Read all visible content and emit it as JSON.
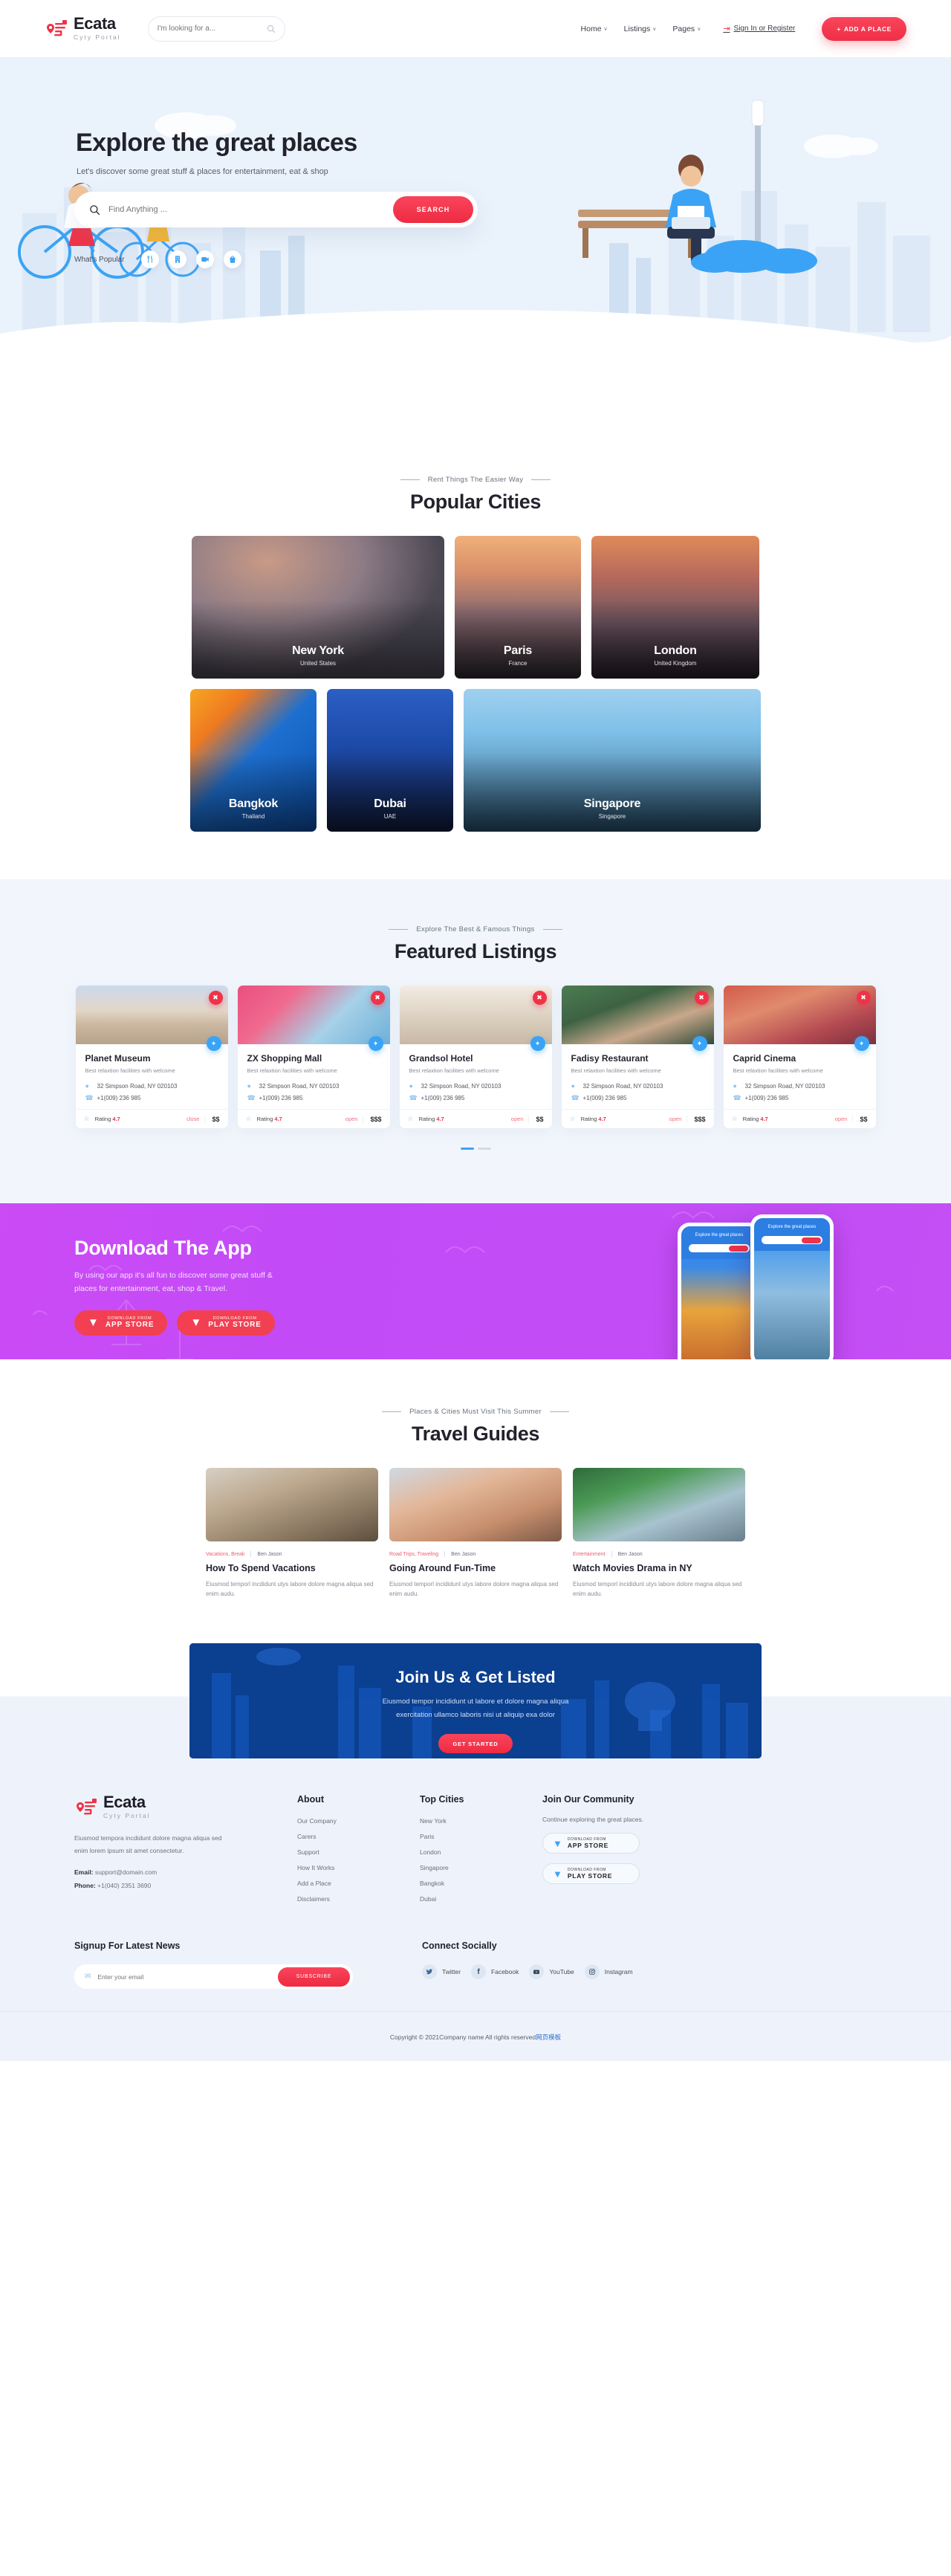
{
  "brand": {
    "name": "Ecata",
    "tagline": "Cyty Portal",
    "logo_icon": "location-pin-icon"
  },
  "header": {
    "search_placeholder": "I'm looking for a...",
    "search_icon": "search-icon",
    "nav": [
      {
        "label": "Home",
        "caret": "∨"
      },
      {
        "label": "Listings",
        "caret": "∨"
      },
      {
        "label": "Pages",
        "caret": "∨"
      }
    ],
    "signin_label": "Sign In or Register",
    "signin_icon": "login-icon",
    "add_place_label": "ADD A PLACE",
    "add_place_icon": "plus-icon"
  },
  "hero": {
    "title": "Explore the great places",
    "subtitle": "Let's discover some great stuff & places for entertainment, eat & shop",
    "search_placeholder": "Find Anything ...",
    "search_icon": "search-icon",
    "search_button": "SEARCH",
    "popular_label": "What's Popular",
    "popular_icons": [
      {
        "name": "restaurant-icon",
        "glyph": "✖"
      },
      {
        "name": "hotel-icon",
        "glyph": "☷"
      },
      {
        "name": "video-icon",
        "glyph": "▶"
      },
      {
        "name": "shopping-icon",
        "glyph": "▮"
      }
    ]
  },
  "cities_section": {
    "kicker": "Rent Things The Easier Way",
    "title": "Popular Cities",
    "cities": [
      {
        "name": "New York",
        "country": "United States",
        "class": "c-ny ph-ny"
      },
      {
        "name": "Paris",
        "country": "France",
        "class": "c-paris ph-paris"
      },
      {
        "name": "London",
        "country": "United Kingdom",
        "class": "c-london ph-london"
      },
      {
        "name": "Bangkok",
        "country": "Thailand",
        "class": "c-bangkok ph-bangkok"
      },
      {
        "name": "Dubai",
        "country": "UAE",
        "class": "c-dubai ph-dubai"
      },
      {
        "name": "Singapore",
        "country": "Singapore",
        "class": "c-singapore ph-singapore"
      }
    ]
  },
  "featured_section": {
    "kicker": "Explore The Best & Famous Things",
    "title": "Featured Listings",
    "listings": [
      {
        "title": "Planet Museum",
        "desc": "Best relaxtion facilities with welcome",
        "address": "32 Simpson Road, NY 020103",
        "phone": "+1(009) 236 985",
        "rating_label": "Rating",
        "rating": "4.7",
        "status": "close",
        "price": "$$",
        "img_class": "ph-museum"
      },
      {
        "title": "ZX Shopping Mall",
        "desc": "Best relaxtion facilities with welcome",
        "address": "32 Simpson Road, NY 020103",
        "phone": "+1(009) 236 985",
        "rating_label": "Rating",
        "rating": "4.7",
        "status": "open",
        "price": "$$$",
        "img_class": "ph-mall"
      },
      {
        "title": "Grandsol Hotel",
        "desc": "Best relaxtion facilities with welcome",
        "address": "32 Simpson Road, NY 020103",
        "phone": "+1(009) 236 985",
        "rating_label": "Rating",
        "rating": "4.7",
        "status": "open",
        "price": "$$",
        "img_class": "ph-hotel"
      },
      {
        "title": "Fadisy Restaurant",
        "desc": "Best relaxtion facilities with welcome",
        "address": "32 Simpson Road, NY 020103",
        "phone": "+1(009) 236 985",
        "rating_label": "Rating",
        "rating": "4.7",
        "status": "open",
        "price": "$$$",
        "img_class": "ph-rest"
      },
      {
        "title": "Caprid Cinema",
        "desc": "Best relaxtion facilities with welcome",
        "address": "32 Simpson Road, NY 020103",
        "phone": "+1(009) 236 985",
        "rating_label": "Rating",
        "rating": "4.7",
        "status": "open",
        "price": "$$",
        "img_class": "ph-cinema"
      }
    ]
  },
  "download_app": {
    "title": "Download The App",
    "desc": "By using our app it's all fun to discover some great stuff & places for entertainment, eat, shop & Travel.",
    "buttons": [
      {
        "line1": "DOWNLOAD FROM",
        "line2": "APP STORE"
      },
      {
        "line1": "DOWNLOAD FROM",
        "line2": "PLAY STORE"
      }
    ],
    "phone_caption": "Explore the great places"
  },
  "guides_section": {
    "kicker": "Places & Cities Must Visit This Summer",
    "title": "Travel Guides",
    "posts": [
      {
        "category": "Vacations, Break",
        "author": "Ben Jason",
        "title": "How To Spend Vacations",
        "excerpt": "Eiusmod temporl incdidunt utys labore dolore magna aliqua sed enim audu.",
        "img_class": "ph-g1"
      },
      {
        "category": "Road Trips, Traveling",
        "author": "Ben Jason",
        "title": "Going Around Fun-Time",
        "excerpt": "Eiusmod temporl incididunt utys labore dolore magna aliqua sed enim audu.",
        "img_class": "ph-g2"
      },
      {
        "category": "Entertainment",
        "author": "Ben Jason",
        "title": "Watch Movies Drama in NY",
        "excerpt": "Eiusmod temporl incididunt utys labore dolore magna aliqua sed enim audu.",
        "img_class": "ph-g3"
      }
    ]
  },
  "join_cta": {
    "title": "Join Us & Get Listed",
    "line1": "Eiusmod tempor incididunt ut labore et dolore magna aliqua",
    "line2": "exercitation ullamco laboris nisi ut aliquip exa dolor",
    "button": "GET STARTED"
  },
  "footer": {
    "desc": "Eiusmod tempora incdidunt dolore magna aliqua sed enim lorem ipsum sit amet consectetur.",
    "email_label": "Email:",
    "email": "support@domain.com",
    "phone_label": "Phone:",
    "phone": "+1(040) 2351 3690",
    "about": {
      "heading": "About",
      "links": [
        "Our Company",
        "Carers",
        "Support",
        "How It Works",
        "Add a Place",
        "Disclaimers"
      ]
    },
    "top_cities": {
      "heading": "Top Cities",
      "links": [
        "New York",
        "Paris",
        "London",
        "Singapore",
        "Bangkok",
        "Dubai"
      ]
    },
    "community": {
      "heading": "Join Our Community",
      "sub": "Continue exploring the great places.",
      "buttons": [
        {
          "line1": "DOWNLOAD FROM",
          "line2": "APP STORE"
        },
        {
          "line1": "DOWNLOAD FROM",
          "line2": "PLAY STORE"
        }
      ]
    },
    "signup": {
      "heading": "Signup For Latest News",
      "placeholder": "Enter your email",
      "button": "SUBSCRIBE",
      "mail_icon": "mail-icon"
    },
    "social": {
      "heading": "Connect Socially",
      "items": [
        {
          "name": "Twitter",
          "icon": "twitter-icon",
          "glyph": "ᴠ"
        },
        {
          "name": "Facebook",
          "icon": "facebook-icon",
          "glyph": "f"
        },
        {
          "name": "YouTube",
          "icon": "youtube-icon",
          "glyph": "▶"
        },
        {
          "name": "Instagram",
          "icon": "instagram-icon",
          "glyph": "▢"
        }
      ]
    },
    "copyright": "Copyright © 2021Company name All rights reserved",
    "copyright_link": "网页模板"
  },
  "colors": {
    "accent": "#ef3348",
    "blue": "#3ba3f5",
    "purple": "#c44ff5",
    "navy": "#0b3f90"
  }
}
